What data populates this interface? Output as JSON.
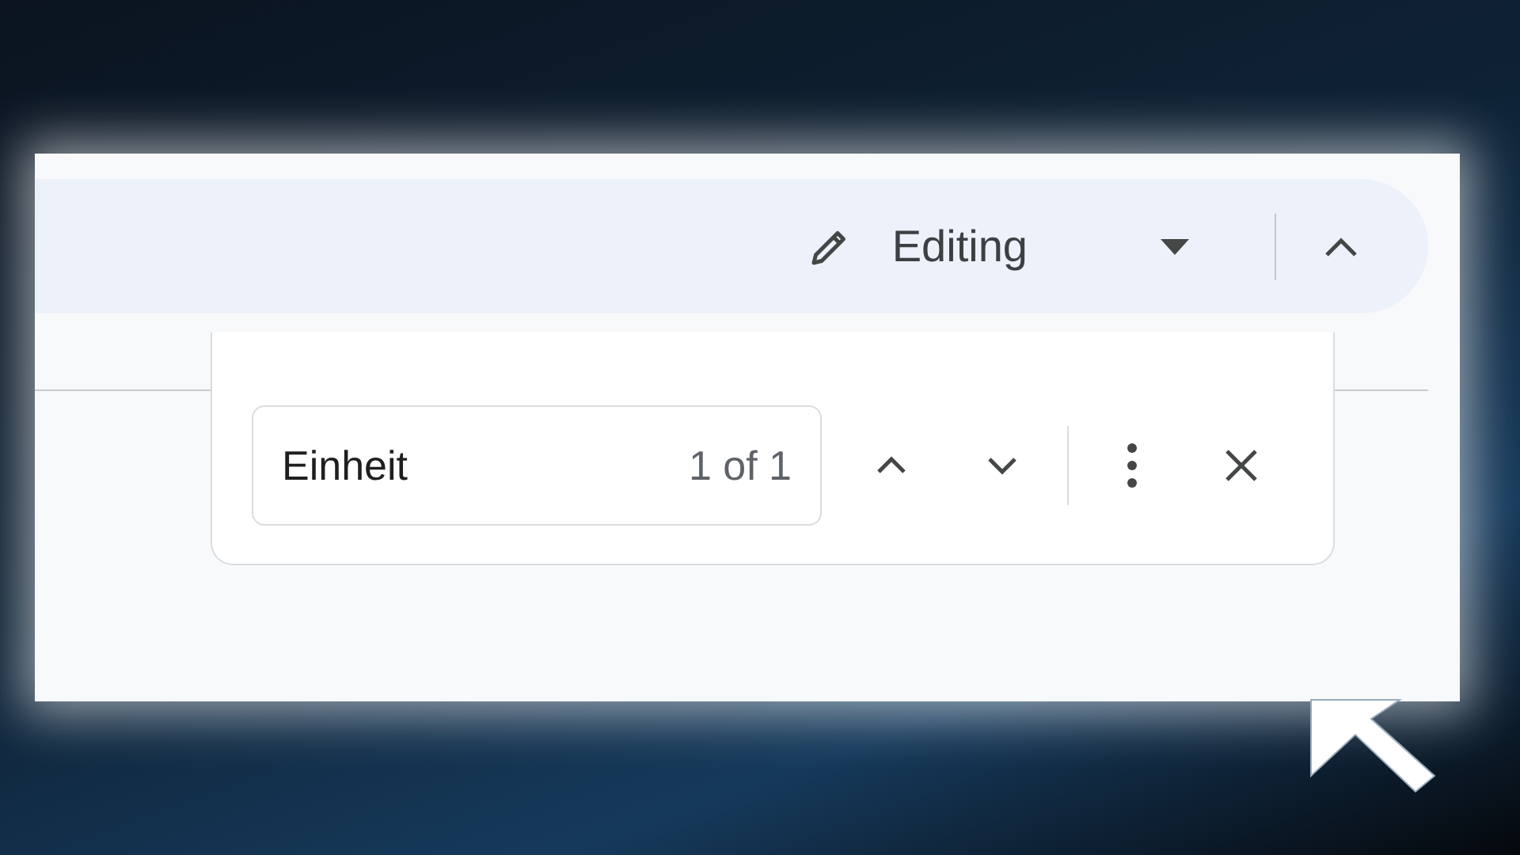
{
  "toolbar": {
    "mode": {
      "label": "Editing"
    }
  },
  "find_bar": {
    "query": {
      "value": "Einheit"
    },
    "match_count": "1 of 1"
  }
}
